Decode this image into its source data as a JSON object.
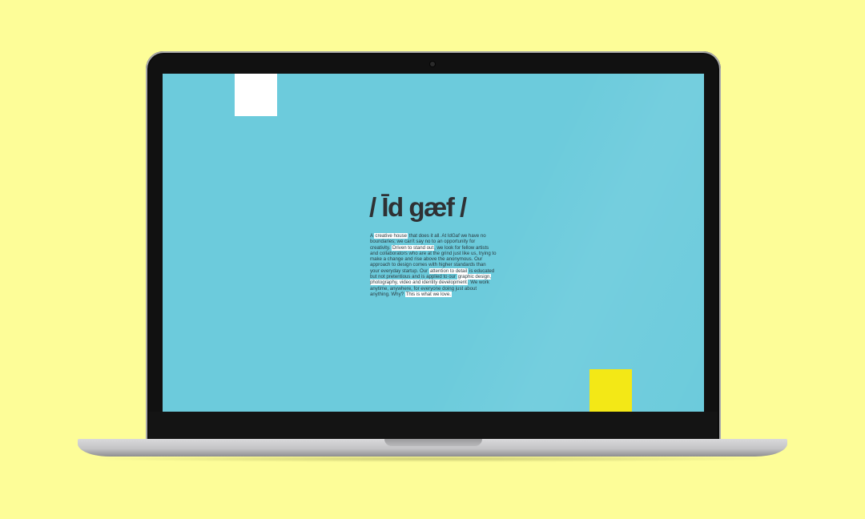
{
  "page": {
    "background_color": "#fdfd98",
    "screen_color": "#6ccbdc"
  },
  "site": {
    "logo": "/ Īd gæf /",
    "blurb": [
      {
        "text": "A ",
        "highlight": false
      },
      {
        "text": "creative house",
        "highlight": true
      },
      {
        "text": " that does it all. At IdGaf we have no boundaries; we can't say no to an opportunity for creativity. ",
        "highlight": false
      },
      {
        "text": "Driven to stand out",
        "highlight": true
      },
      {
        "text": ", we look for fellow artists and collaborators who are at the grind just like us, trying to make a change and rise above the anonymous. Our approach to design comes with higher standards than your everyday startup. Our ",
        "highlight": false
      },
      {
        "text": "attention to detail",
        "highlight": true
      },
      {
        "text": " is educated but not pretentious and is applied to our ",
        "highlight": false
      },
      {
        "text": "graphic design, photography, video and identity development",
        "highlight": true
      },
      {
        "text": ". We work anytime, anywhere, for everyone doing just about anything. Why? ",
        "highlight": false
      },
      {
        "text": "This is what we love.",
        "highlight": true
      }
    ],
    "accent_colors": {
      "white_block": "#ffffff",
      "yellow_block": "#f3e816"
    }
  }
}
